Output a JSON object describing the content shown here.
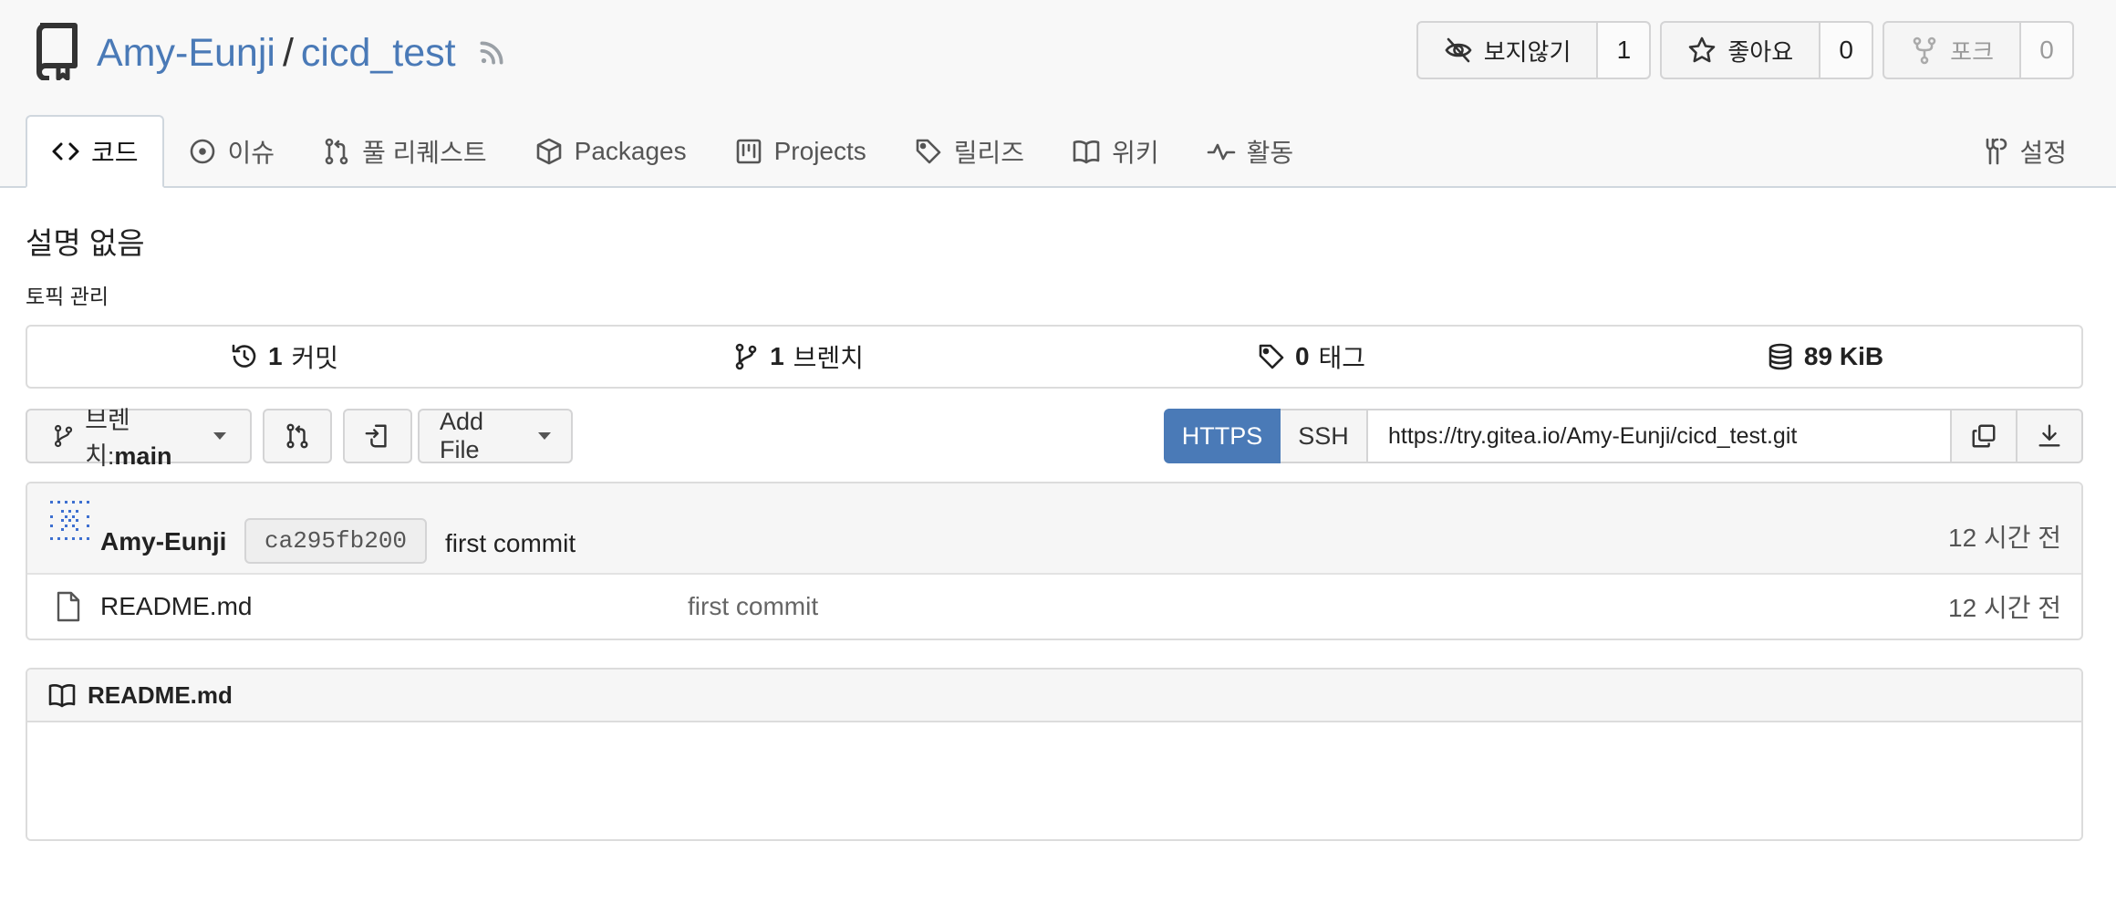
{
  "repo": {
    "owner": "Amy-Eunji",
    "separator": "/",
    "name": "cicd_test"
  },
  "header_buttons": {
    "watch": {
      "label": "보지않기",
      "count": "1"
    },
    "star": {
      "label": "좋아요",
      "count": "0"
    },
    "fork": {
      "label": "포크",
      "count": "0"
    }
  },
  "tabs": [
    {
      "label": "코드",
      "icon": "code-icon"
    },
    {
      "label": "이슈",
      "icon": "issue-icon"
    },
    {
      "label": "풀 리퀘스트",
      "icon": "pull-request-icon"
    },
    {
      "label": "Packages",
      "icon": "package-icon"
    },
    {
      "label": "Projects",
      "icon": "project-icon"
    },
    {
      "label": "릴리즈",
      "icon": "tag-icon"
    },
    {
      "label": "위키",
      "icon": "book-icon"
    },
    {
      "label": "활동",
      "icon": "pulse-icon"
    },
    {
      "label": "설정",
      "icon": "tools-icon"
    }
  ],
  "description": "설명 없음",
  "topics_link": "토픽 관리",
  "stats": [
    {
      "value": "1",
      "label": "커밋",
      "icon": "history-icon"
    },
    {
      "value": "1",
      "label": "브렌치",
      "icon": "branch-icon"
    },
    {
      "value": "0",
      "label": "태그",
      "icon": "tag-icon"
    },
    {
      "value": "89 KiB",
      "label": "",
      "icon": "database-icon"
    }
  ],
  "toolbar": {
    "branch_prefix": "브렌치:",
    "branch_name": "main",
    "add_file_label": "Add File"
  },
  "clone": {
    "https_label": "HTTPS",
    "ssh_label": "SSH",
    "url": "https://try.gitea.io/Amy-Eunji/cicd_test.git"
  },
  "latest_commit": {
    "author": "Amy-Eunji",
    "sha": "ca295fb200",
    "message": "first commit",
    "time": "12 시간 전"
  },
  "files": [
    {
      "name": "README.md",
      "message": "first commit",
      "time": "12 시간 전"
    }
  ],
  "readme": {
    "title": "README.md"
  },
  "colors": {
    "link": "#4a7ab7",
    "primary_button": "#4a7ab7"
  }
}
